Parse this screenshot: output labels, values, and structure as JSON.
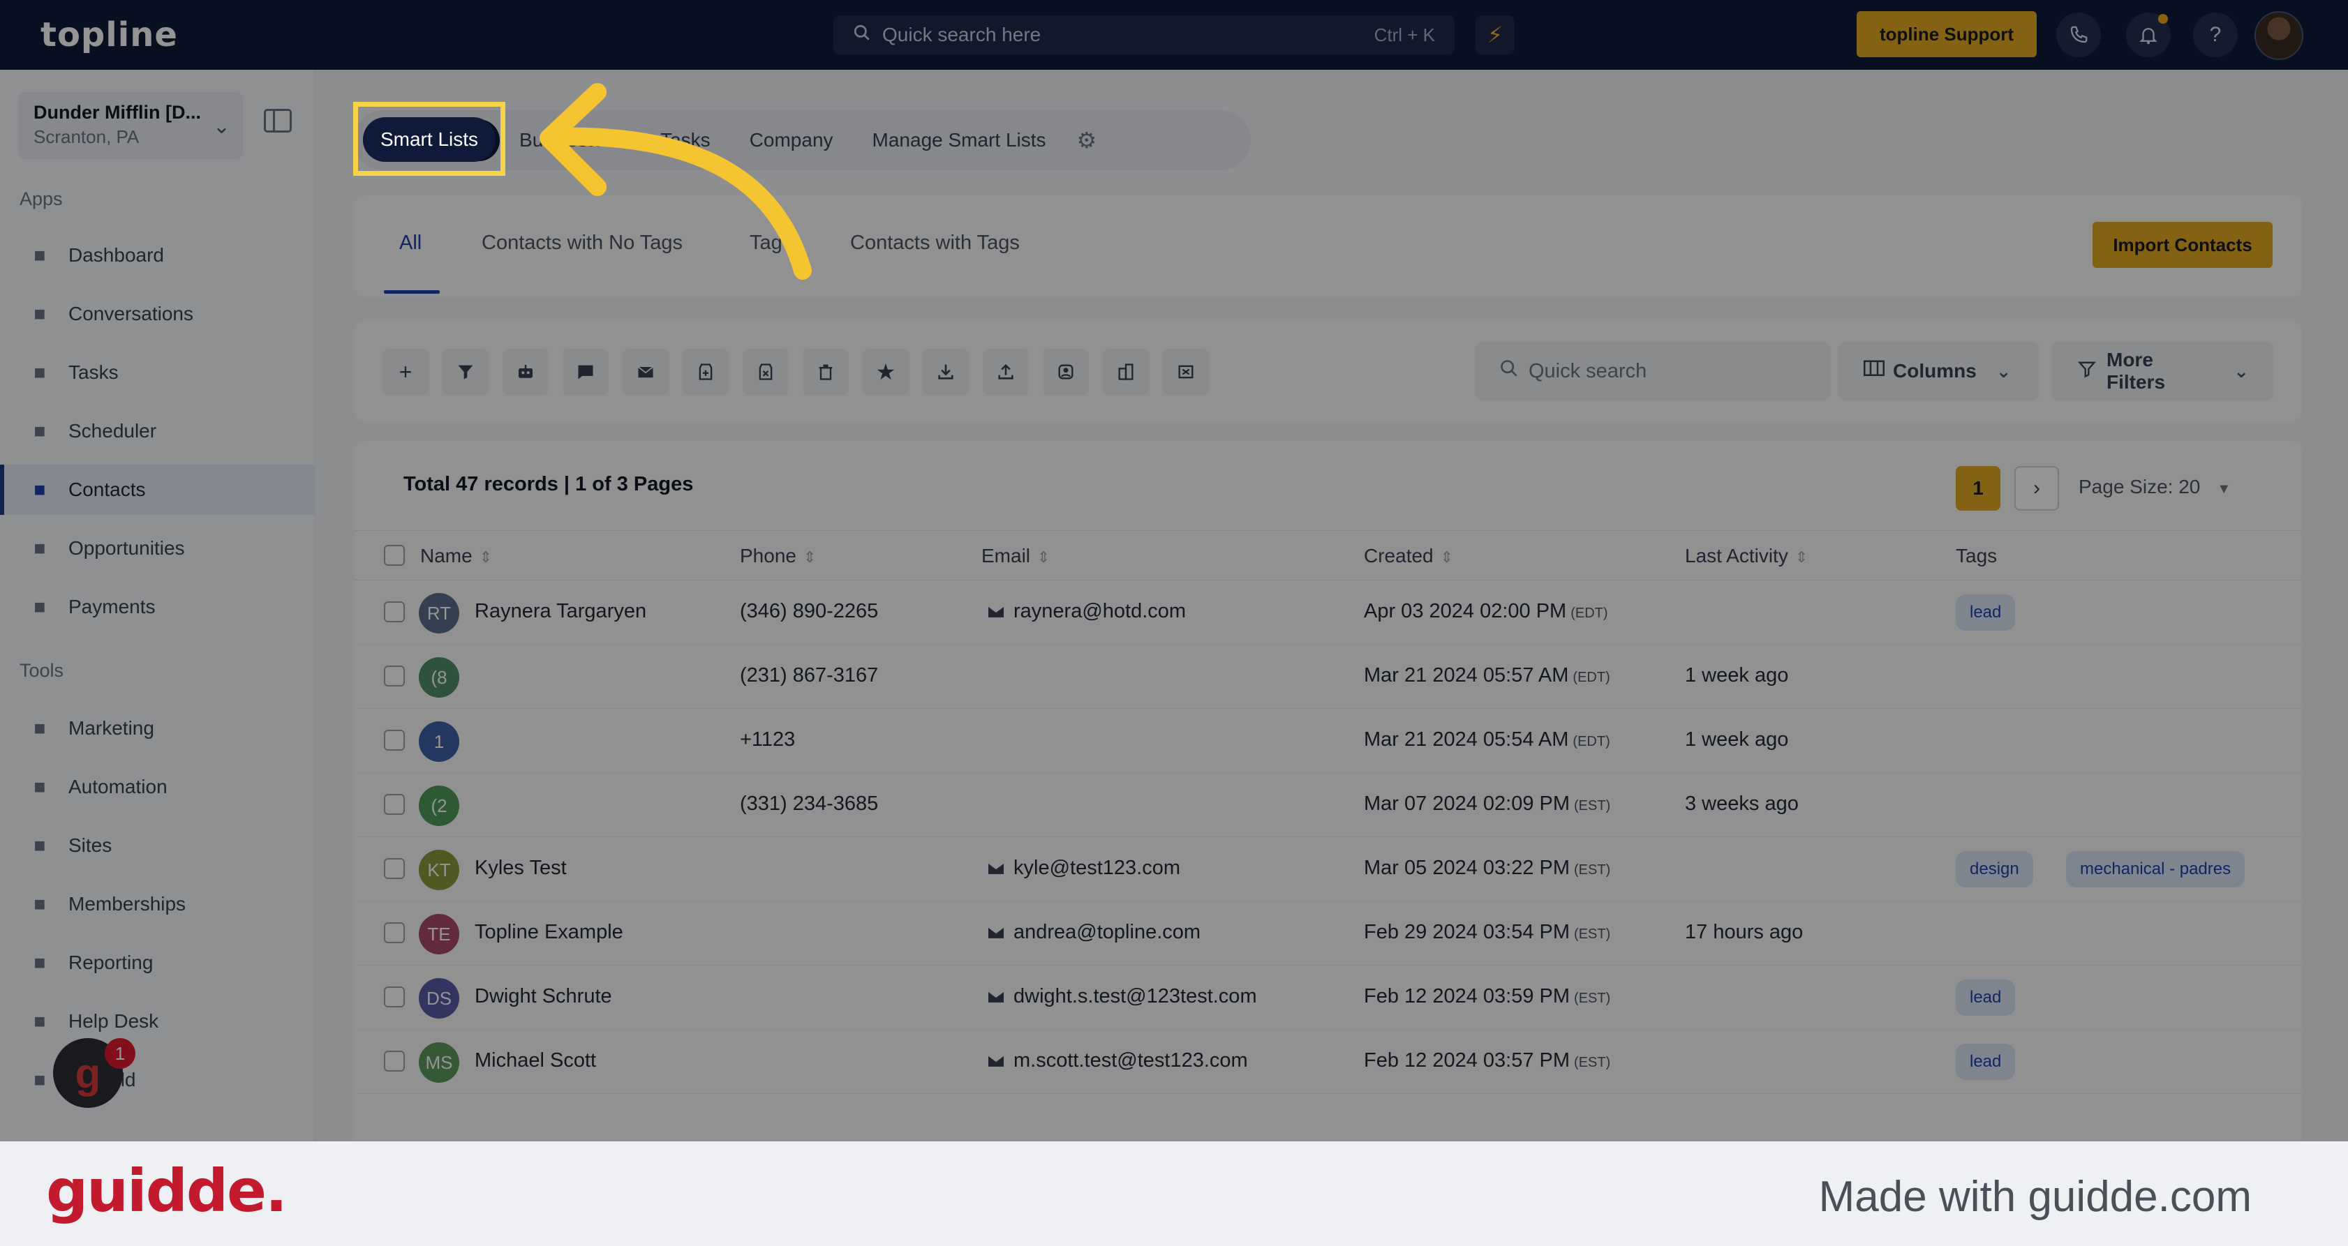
{
  "topbar": {
    "logo": "topline",
    "search_placeholder": "Quick search here",
    "search_shortcut": "Ctrl + K",
    "support_label": "topline Support"
  },
  "sidebar": {
    "account_name": "Dunder Mifflin [D...",
    "account_location": "Scranton, PA",
    "apps_label": "Apps",
    "tools_label": "Tools",
    "apps": [
      {
        "label": "Dashboard",
        "icon": "dashboard-icon"
      },
      {
        "label": "Conversations",
        "icon": "chat-icon"
      },
      {
        "label": "Tasks",
        "icon": "clipboard-icon"
      },
      {
        "label": "Scheduler",
        "icon": "calendar-icon"
      },
      {
        "label": "Contacts",
        "icon": "person-icon",
        "active": true
      },
      {
        "label": "Opportunities",
        "icon": "target-icon"
      },
      {
        "label": "Payments",
        "icon": "card-icon"
      }
    ],
    "tools": [
      {
        "label": "Marketing",
        "icon": "megaphone-icon"
      },
      {
        "label": "Automation",
        "icon": "gears-icon"
      },
      {
        "label": "Sites",
        "icon": "globe-icon"
      },
      {
        "label": "Memberships",
        "icon": "group-icon"
      },
      {
        "label": "Reporting",
        "icon": "pie-icon"
      },
      {
        "label": "Help Desk",
        "icon": "question-icon"
      },
      {
        "label": "Mailfold",
        "icon": "mailbox-icon"
      }
    ],
    "help_badge": "1"
  },
  "main": {
    "top_tabs": [
      "Smart Lists",
      "Bu",
      "estore",
      "Tasks",
      "Company",
      "Manage Smart Lists"
    ],
    "sub_tabs": [
      "All",
      "Contacts with No Tags",
      "Tag",
      "Contacts with Tags"
    ],
    "import_label": "Import Contacts",
    "quick_search_placeholder": "Quick search",
    "columns_label": "Columns",
    "more_filters_label": "More Filters",
    "records_text": "Total 47 records | 1 of 3 Pages",
    "current_page": "1",
    "page_size": "Page Size: 20",
    "columns": [
      "Name",
      "Phone",
      "Email",
      "Created",
      "Last Activity",
      "Tags"
    ],
    "rows": [
      {
        "initials": "RT",
        "color": "#5b6e8c",
        "name": "Raynera Targaryen",
        "phone": "(346) 890-2265",
        "email": "raynera@hotd.com",
        "created": "Apr 03 2024 02:00 PM",
        "tz": "(EDT)",
        "activity": "",
        "tags": [
          "lead"
        ]
      },
      {
        "initials": "(8",
        "color": "#4f8f6a",
        "name": "",
        "phone": "(231) 867-3167",
        "email": "",
        "created": "Mar 21 2024 05:57 AM",
        "tz": "(EDT)",
        "activity": "1 week ago",
        "tags": []
      },
      {
        "initials": "1",
        "color": "#3f5fa8",
        "name": "",
        "phone": "+1123",
        "email": "",
        "created": "Mar 21 2024 05:54 AM",
        "tz": "(EDT)",
        "activity": "1 week ago",
        "tags": []
      },
      {
        "initials": "(2",
        "color": "#4f9a58",
        "name": "",
        "phone": "(331) 234-3685",
        "email": "",
        "created": "Mar 07 2024 02:09 PM",
        "tz": "(EST)",
        "activity": "3 weeks ago",
        "tags": []
      },
      {
        "initials": "KT",
        "color": "#8a9a3c",
        "name": "Kyles Test",
        "phone": "",
        "email": "kyle@test123.com",
        "created": "Mar 05 2024 03:22 PM",
        "tz": "(EST)",
        "activity": "",
        "tags": [
          "design",
          "mechanical - padres"
        ]
      },
      {
        "initials": "TE",
        "color": "#a84a6a",
        "name": "Topline Example",
        "phone": "",
        "email": "andrea@topline.com",
        "created": "Feb 29 2024 03:54 PM",
        "tz": "(EST)",
        "activity": "17 hours ago",
        "tags": []
      },
      {
        "initials": "DS",
        "color": "#5a5aa8",
        "name": "Dwight Schrute",
        "phone": "",
        "email": "dwight.s.test@123test.com",
        "created": "Feb 12 2024 03:59 PM",
        "tz": "(EST)",
        "activity": "",
        "tags": [
          "lead"
        ]
      },
      {
        "initials": "MS",
        "color": "#5a9a5a",
        "name": "Michael Scott",
        "phone": "",
        "email": "m.scott.test@test123.com",
        "created": "Feb 12 2024 03:57 PM",
        "tz": "(EST)",
        "activity": "",
        "tags": [
          "lead"
        ]
      }
    ]
  },
  "footer": {
    "brand": "guidde.",
    "made_with": "Made with guidde.com"
  },
  "colors": {
    "accent": "#e2aa22",
    "navy": "#0f1a3a",
    "highlight": "#f5d34a",
    "brand_red": "#c41a2e"
  }
}
